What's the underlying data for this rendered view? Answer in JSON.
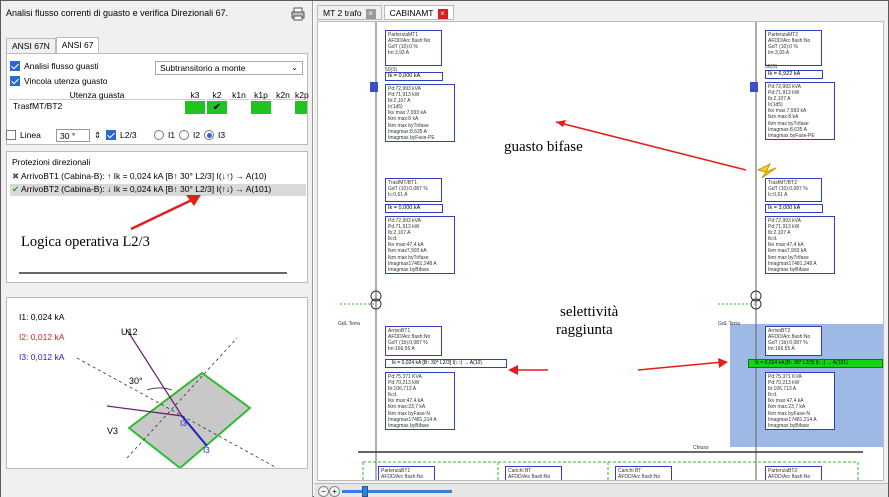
{
  "left_panel": {
    "title": "Analisi flusso correnti di guasto e verifica Direzionali 67.",
    "tabs": [
      "ANSI 67N",
      "ANSI 67"
    ],
    "options": {
      "analisi_label": "Analisi flusso guasti",
      "vincola_label": "Vincola utenza guasto",
      "transitorio_select": "Subtransitorio a monte"
    },
    "fault_grid": {
      "headers": [
        "Utenza guasta",
        "k3",
        "k2",
        "k1n",
        "k1p",
        "k2n",
        "k2p"
      ],
      "row_name": "TrasfMT/BT2",
      "selected_check": "✔"
    },
    "line_controls": {
      "linea_label": "Linea",
      "angle_value": "30 °",
      "l23_label": "L2/3",
      "radio_labels": [
        "I1",
        "I2",
        "I3"
      ]
    },
    "protections": {
      "title": "Protezioni direzionali",
      "items": [
        "ArrivoBT1 (Cabina-B): ↑ Ik = 0,024 kA [B↑ 30° L2/3] I(↓↑) → A(10)",
        "ArrivoBT2 (Cabina-B): ↓ Ik = 0,024 kA [B↑ 30° L2/3] I(↑↓) → A(101)"
      ],
      "annotation": "Logica operativa L2/3"
    },
    "vector_diagram": {
      "i1": "I1: 0,024 kA",
      "i2": "I2: 0,012 kA",
      "i3": "I3: 0,012 kA",
      "u12": "U12",
      "v3": "V3",
      "angle": "30°",
      "i3_short": "I3",
      "colors": {
        "i1": "#000000",
        "i2": "#e02020",
        "i3": "#1f1fbf",
        "sector": "#2bbf2b",
        "fill": "#c8c8c8"
      }
    }
  },
  "right_panel": {
    "tabs": [
      "MT 2 trafo",
      "CABINAMT"
    ],
    "annotations": {
      "guasto": "guasto bifase",
      "selettivita_1": "selettività",
      "selettivita_2": "raggiunta"
    },
    "boxes": {
      "partenza1": "PartenzaMT1\nAFDD/Arc flash:No\nGdT (10):0 %\nIm:3,93 A",
      "partenza2": "PartenzaMT2\nAFDD/Arc flash:No\nGdT (10):0 %\nIm:3,93 A",
      "ik_top1": "Ik = 0,000 kA",
      "ik_top2": "Ik = 6,922 kA",
      "pd1": "Pd:72,993 kVA\nPd:71,913 kW\nIb:2,107 A\nIr(1d5)\nIkv max:7,993 kA\nIkm max:8 kA\nIkm max byTrifase\nImagmax:8,635 A\nImagmax byFase-PE",
      "pd2": "Pd:72,993 kVA\nPd:71,913 kW\nIb:2,107 A\nIr(1d5)\nIkv max:7,993 kA\nIkm max:8 kA\nIkm max byTrifase\nImagmax:8,635 A\nImagmax byFase-PE",
      "trasf1": "TrasfMT/BT1\nGdT (10):0,087 %\nIc:0,61 A",
      "trasf2": "TrasfMT/BT2\nGdT (10):0,087 %\nIc:0,61 A",
      "ik_mid1": "Ik = 0,000 kA",
      "ik_mid2": "Ik = 3,000 kA",
      "pd3": "Pd:72,993 kVA\nPd:71,913 kW\nIb:2,107 A\nIk:d.\nIkv max:47,4 kA\nIkm max7,993 kA\nIkm max byTrifase\nImagmax17481,248 A\nImagmax byBifase",
      "pd4": "Pd:72,993 kVA\nPd:71,913 kW\nIb:2,107 A\nIk:d.\nIkv max:47,4 kA\nIkm max7,993 kA\nIkm max byTrifase\nImagmax17481,248 A\nImagmax byBifase",
      "arrivo1": "ArrivoBT1\nAFDD/Arc flash:No\nGdT (1b):0,087 %\nIm:166,55 A",
      "arrivo2": "ArrivoBT2\nAFDD/Arc flash:No\nGdT (1b):0,087 %\nIm:166,55 A",
      "bar1": "Ik = 0,024 kA [B↑ 30° L2/3] I(↓↑) → A(10)",
      "bar2": "Ik = 0,024 kA [B↑ 30° L2/3] I(↑↓) → A(101)",
      "pd5": "Pd:75,371 KVA\nPd:70,213 kW\nIb:106,713 A\nIk:d.\nIkv max:47,4 kA\nIkm max:23,7 kA\nIkm max byFase-N\nImagmax17481,214 A\nImagmax byBifase",
      "pd6": "Pd:75,371 KVA\nPd:70,213 kW\nIb:106,713 A\nIk:d.\nIkv max:47,4 kA\nIkm max:23,7 kA\nIkm max byFase-N\nImagmax17481,214 A\nImagmax byBifase",
      "bottom1": "PartenzaBT1\nAFDD/Arc flash:No",
      "bottom2": "Carichi BT\nAFDD/Arc flash:No",
      "bottom3": "Carichi BT\nAFDD/Arc flash:No",
      "bottom4": "PartenzaBT2\nAFDD/Arc flash:No",
      "sel50": "50(S)",
      "gdt_label": "GdL Terra",
      "chiuso": "Chiuso"
    }
  }
}
